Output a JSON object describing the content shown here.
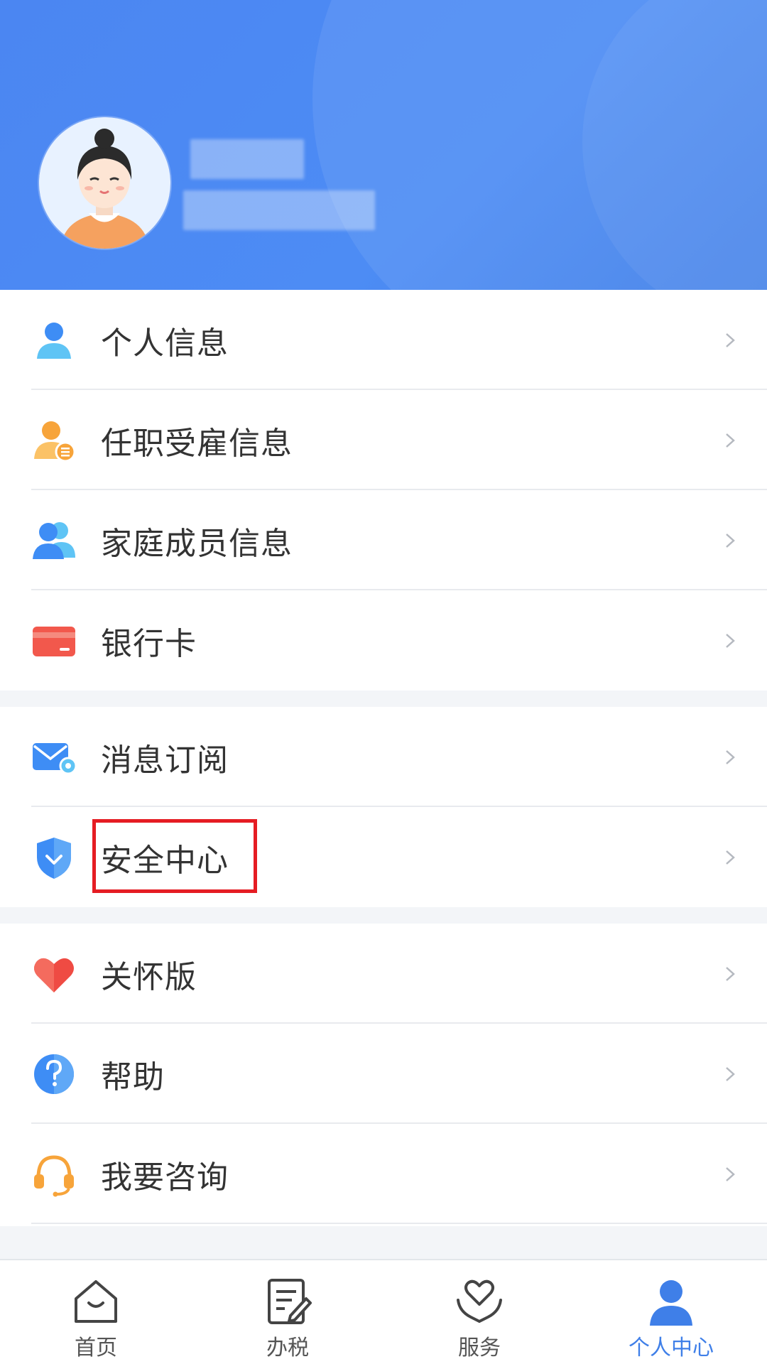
{
  "colors": {
    "accent": "#3f7fe8",
    "highlight": "#e51c23"
  },
  "menu": {
    "section1": [
      {
        "label": "个人信息",
        "icon": "person-icon"
      },
      {
        "label": "任职受雇信息",
        "icon": "employment-icon"
      },
      {
        "label": "家庭成员信息",
        "icon": "family-icon"
      },
      {
        "label": "银行卡",
        "icon": "bank-card-icon"
      }
    ],
    "section2": [
      {
        "label": "消息订阅",
        "icon": "mail-settings-icon"
      },
      {
        "label": "安全中心",
        "icon": "shield-icon"
      }
    ],
    "section3": [
      {
        "label": "关怀版",
        "icon": "heart-icon"
      },
      {
        "label": "帮助",
        "icon": "help-icon"
      },
      {
        "label": "我要咨询",
        "icon": "headset-icon"
      }
    ]
  },
  "tabs": [
    {
      "label": "首页",
      "icon": "home-icon"
    },
    {
      "label": "办税",
      "icon": "tax-form-icon"
    },
    {
      "label": "服务",
      "icon": "service-heart-icon"
    },
    {
      "label": "个人中心",
      "icon": "profile-icon"
    }
  ]
}
